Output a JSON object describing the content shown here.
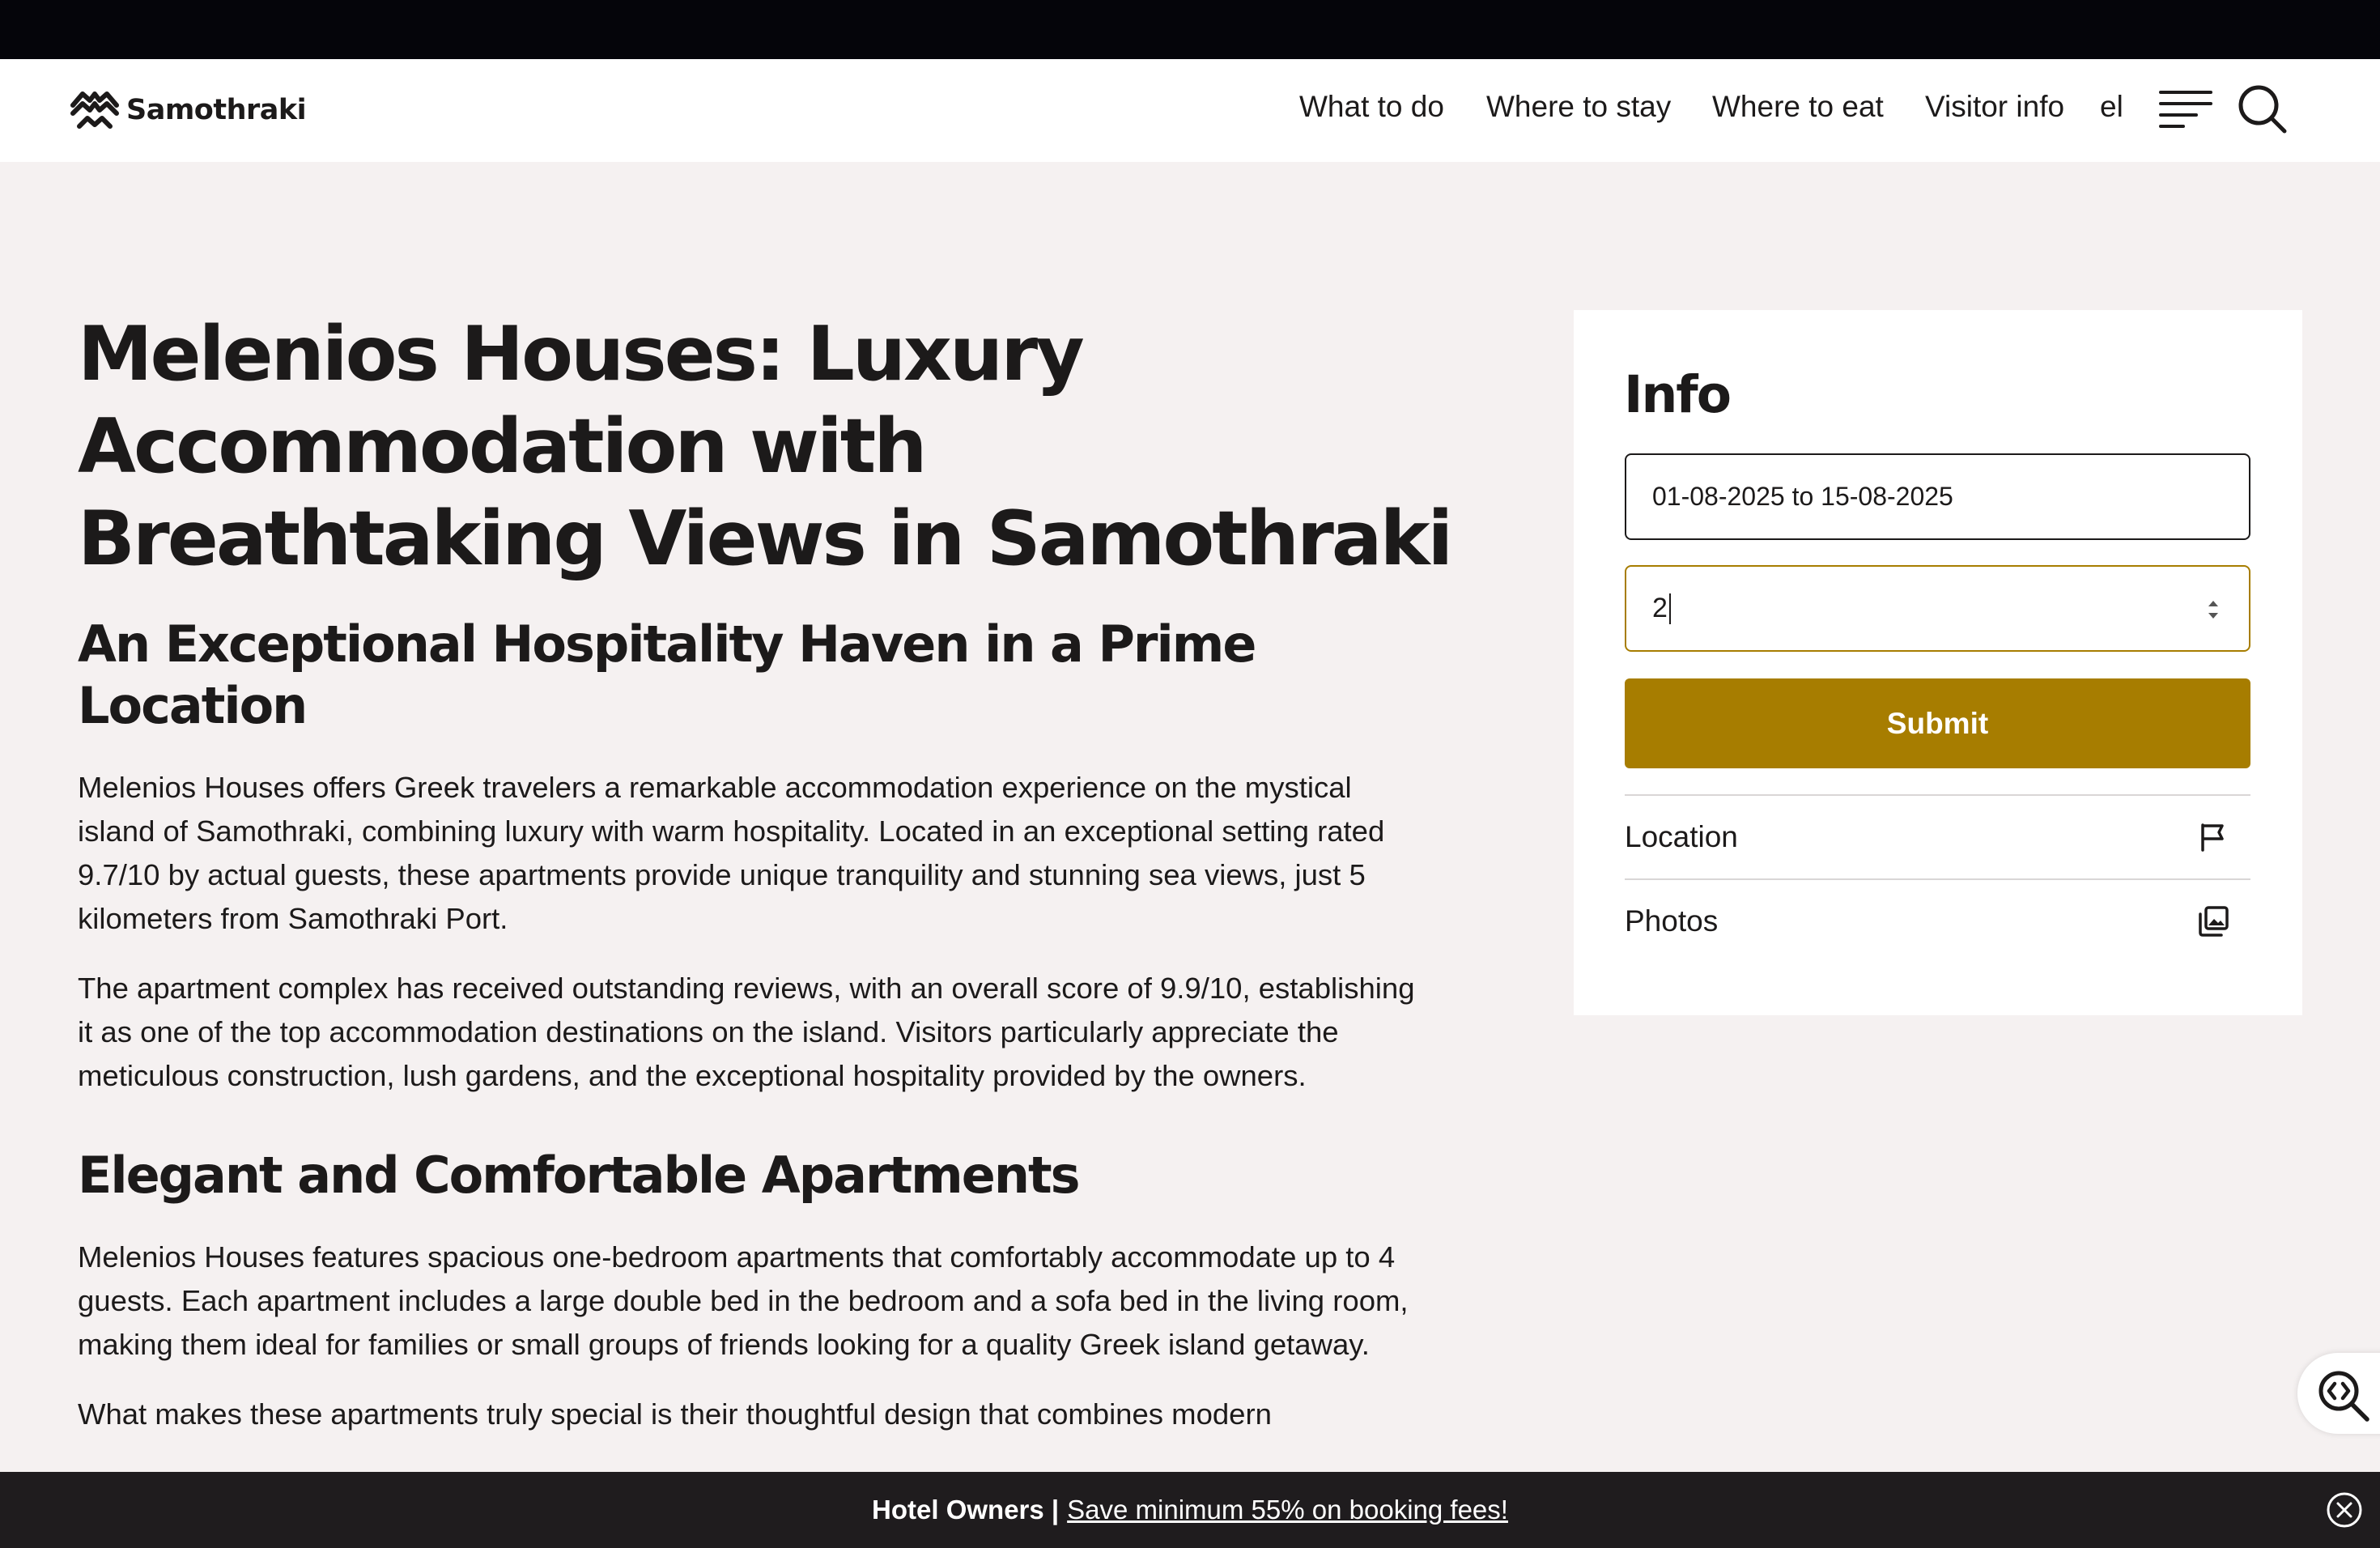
{
  "header": {
    "logo_text": "Samothraki",
    "nav": [
      "What to do",
      "Where to stay",
      "Where to eat",
      "Visitor info",
      "el"
    ]
  },
  "article": {
    "title": "Melenios Houses: Luxury Accommodation with Breathtaking Views in Samothraki",
    "section1_heading": "An Exceptional Hospitality Haven in a Prime Location",
    "para1": "Melenios Houses offers Greek travelers a remarkable accommodation experience on the mystical island of Samothraki, combining luxury with warm hospitality. Located in an exceptional setting rated 9.7/10 by actual guests, these apartments provide unique tranquility and stunning sea views, just 5 kilometers from Samothraki Port.",
    "para2": "The apartment complex has received outstanding reviews, with an overall score of 9.9/10, establishing it as one of the top accommodation destinations on the island. Visitors particularly appreciate the meticulous construction, lush gardens, and the exceptional hospitality provided by the owners.",
    "section2_heading": "Elegant and Comfortable Apartments",
    "para3": "Melenios Houses features spacious one-bedroom apartments that comfortably accommodate up to 4 guests. Each apartment includes a large double bed in the bedroom and a sofa bed in the living room, making them ideal for families or small groups of friends looking for a quality Greek island getaway.",
    "para4": "What makes these apartments truly special is their thoughtful design that combines modern"
  },
  "info_card": {
    "title": "Info",
    "date_range": "01-08-2025 to 15-08-2025",
    "guests_value": "2",
    "submit_label": "Submit",
    "location_label": "Location",
    "photos_label": "Photos"
  },
  "bottom_bar": {
    "label": "Hotel Owners |",
    "link_text": "Save minimum 55% on booking fees!"
  },
  "colors": {
    "accent": "#a77d00",
    "page_bg": "#f5f1f1",
    "bottom_bar_bg": "#1f1c1e"
  },
  "icons": [
    "logo-icon",
    "menu-icon",
    "search-icon",
    "spinner-icon",
    "flag-icon",
    "photos-icon",
    "inspector-icon",
    "close-icon"
  ]
}
